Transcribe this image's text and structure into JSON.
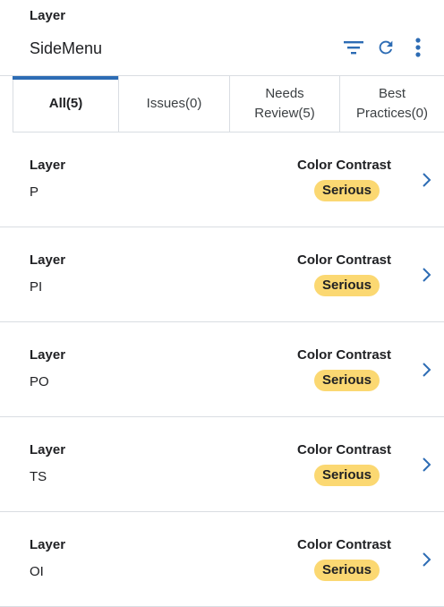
{
  "header": {
    "subtitle": "Layer",
    "title": "SideMenu"
  },
  "toolbar": {
    "filter_icon": "filter-icon",
    "refresh_icon": "refresh-icon",
    "more_icon": "more-vert-icon",
    "accent": "#2d6cb4"
  },
  "tabs": [
    {
      "line1": "All(5)",
      "line2": "",
      "active": true
    },
    {
      "line1": "Issues(0)",
      "line2": "",
      "active": false
    },
    {
      "line1": "Needs",
      "line2": "Review(5)",
      "active": false
    },
    {
      "line1": "Best",
      "line2": "Practices(0)",
      "active": false
    }
  ],
  "items": [
    {
      "label": "Layer",
      "value": "P",
      "rule": "Color Contrast",
      "severity": "Serious"
    },
    {
      "label": "Layer",
      "value": "PI",
      "rule": "Color Contrast",
      "severity": "Serious"
    },
    {
      "label": "Layer",
      "value": "PO",
      "rule": "Color Contrast",
      "severity": "Serious"
    },
    {
      "label": "Layer",
      "value": "TS",
      "rule": "Color Contrast",
      "severity": "Serious"
    },
    {
      "label": "Layer",
      "value": "OI",
      "rule": "Color Contrast",
      "severity": "Serious"
    }
  ],
  "colors": {
    "badge_bg": "#fbd872",
    "chevron": "#2d6cb4"
  }
}
